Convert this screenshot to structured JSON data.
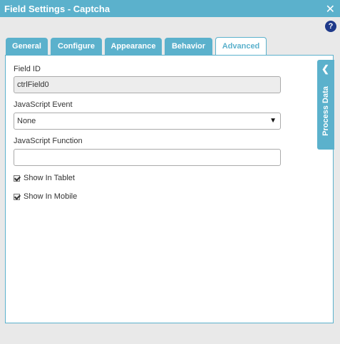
{
  "window": {
    "title": "Field Settings - Captcha",
    "close_glyph": "✕",
    "help_glyph": "?"
  },
  "tabs": [
    {
      "label": "General"
    },
    {
      "label": "Configure"
    },
    {
      "label": "Appearance"
    },
    {
      "label": "Behavior"
    },
    {
      "label": "Advanced",
      "active": true
    }
  ],
  "form": {
    "field_id_label": "Field ID",
    "field_id_value": "ctrlField0",
    "js_event_label": "JavaScript Event",
    "js_event_value": "None",
    "js_function_label": "JavaScript Function",
    "js_function_value": "",
    "show_tablet_label": "Show In Tablet",
    "show_tablet_checked": true,
    "show_mobile_label": "Show In Mobile",
    "show_mobile_checked": true
  },
  "side_panel": {
    "label": "Process Data",
    "chevron": "❮"
  },
  "colors": {
    "accent": "#5bb1cc",
    "help": "#1f3a8a"
  }
}
